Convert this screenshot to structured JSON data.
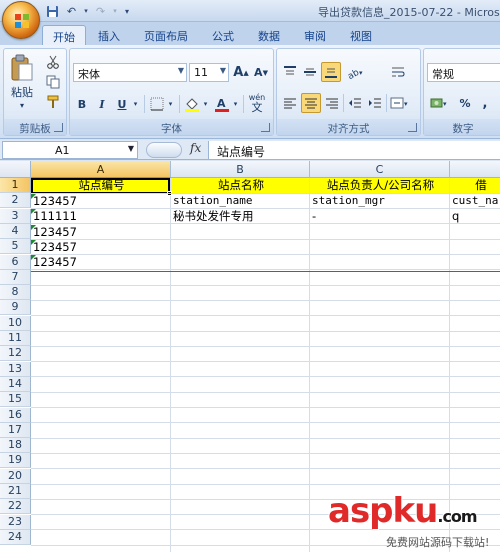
{
  "window": {
    "title": "导出贷款信息_2015-07-22 - Microso"
  },
  "qat": {
    "save_glyph": "💾",
    "undo_glyph": "↶",
    "redo_glyph": "↷",
    "more_glyph": "▾"
  },
  "tabs": [
    {
      "label": "开始",
      "active": true
    },
    {
      "label": "插入"
    },
    {
      "label": "页面布局"
    },
    {
      "label": "公式"
    },
    {
      "label": "数据"
    },
    {
      "label": "审阅"
    },
    {
      "label": "视图"
    }
  ],
  "ribbon": {
    "clipboard": {
      "label": "剪贴板",
      "paste_label": "粘贴"
    },
    "font": {
      "label": "字体",
      "font_name": "宋体",
      "font_size": "11",
      "grow": "A",
      "shrink": "A",
      "bold": "B",
      "italic": "I",
      "underline": "U",
      "phonetic": "wén"
    },
    "alignment": {
      "label": "对齐方式"
    },
    "number": {
      "label": "数字",
      "format": "常规",
      "percent": "%",
      "comma": ","
    }
  },
  "formula_bar": {
    "name_box": "A1",
    "fx": "fx",
    "content": "站点编号"
  },
  "columns": [
    "A",
    "B",
    "C",
    "借"
  ],
  "rows": [
    "1",
    "2",
    "3",
    "4",
    "5",
    "6",
    "7",
    "8",
    "9",
    "10",
    "11",
    "12",
    "13",
    "14",
    "15",
    "16",
    "17",
    "18",
    "19",
    "20",
    "21",
    "22",
    "23",
    "24"
  ],
  "cells": {
    "row1": [
      "站点编号",
      "站点名称",
      "站点负责人/公司名称",
      "借"
    ],
    "row2": [
      "123457",
      "station_name",
      "station_mgr",
      "cust_na"
    ],
    "row3": [
      "111111",
      "秘书处发件专用",
      "-",
      "q"
    ],
    "row4": [
      "123457"
    ],
    "row5": [
      "123457"
    ],
    "row6": [
      "123457"
    ]
  },
  "watermark": {
    "brand_a": "asp",
    "brand_b": "ku",
    "brand_c": ".com",
    "sub": "免费网站源码下载站!"
  },
  "colors": {
    "header_fill": "#ffff00",
    "selection": "#f4c462",
    "accent": "#15428b"
  }
}
